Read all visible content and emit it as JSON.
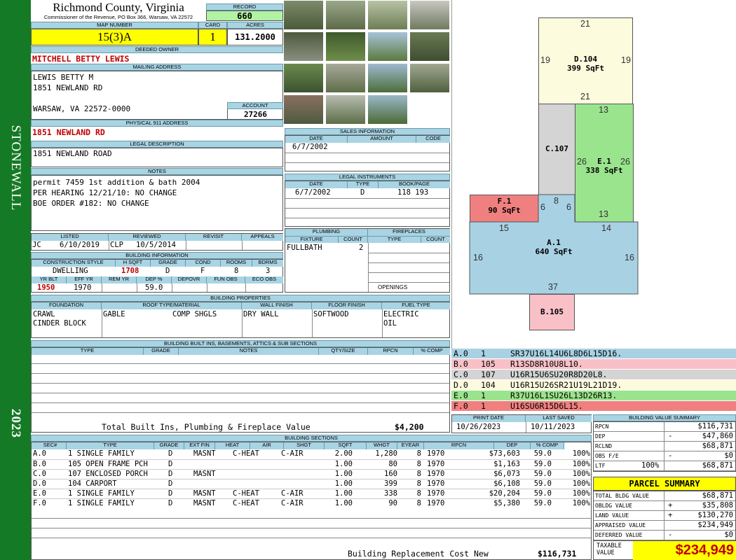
{
  "sidebar": {
    "name": "STONEWALL",
    "year": "2023"
  },
  "header": {
    "county": "Richmond County, Virginia",
    "commissioner": "Commissioner of the Revenue, PO Box 366, Warsaw, VA 22572",
    "record_label": "RECORD",
    "record": "660",
    "map_label": "MAP NUMBER",
    "map_number": "15(3)A",
    "card_label": "CARD",
    "card": "1",
    "acres_label": "ACRES",
    "acres": "131.2000"
  },
  "owner": {
    "deeded_label": "DEEDED OWNER",
    "deeded_owner": "MITCHELL BETTY LEWIS",
    "mailing_label": "MAILING ADDRESS",
    "mailing_lines": [
      "LEWIS BETTY M",
      "1851 NEWLAND RD",
      "",
      "WARSAW, VA 22572-0000"
    ],
    "account_label": "ACCOUNT",
    "account": "27266",
    "physical_label": "PHYSICAL 911 ADDRESS",
    "physical": "1851 NEWLAND RD",
    "legal_label": "LEGAL DESCRIPTION",
    "legal": "1851 NEWLAND ROAD",
    "notes_label": "NOTES",
    "notes": [
      "permit 7459 1st addition & bath 2004",
      "PER HEARING 12/21/10: NO CHANGE",
      "BOE ORDER #182: NO CHANGE"
    ]
  },
  "sales": {
    "label": "SALES INFORMATION",
    "cols": [
      "DATE",
      "AMOUNT",
      "CODE"
    ],
    "rows": [
      [
        "6/7/2002",
        "",
        ""
      ]
    ]
  },
  "legal_instruments": {
    "label": "LEGAL INSTRUMENTS",
    "cols": [
      "DATE",
      "TYPE",
      "BOOK/PAGE"
    ],
    "rows": [
      [
        "6/7/2002",
        "D",
        "118 193"
      ]
    ]
  },
  "listed": {
    "listed_label": "LISTED",
    "reviewed_label": "REVIEWED",
    "revisit_label": "REVISIT",
    "appeals_label": "APPEALS",
    "listed_by": "JC",
    "listed_date": "6/10/2019",
    "reviewed_by": "CLP",
    "reviewed_date": "10/5/2014"
  },
  "building_info": {
    "label": "BUILDING INFORMATION",
    "cols": [
      "CONSTRUCTION STYLE",
      "H SQFT",
      "GRADE",
      "COND",
      "ROOMS",
      "BDRMS"
    ],
    "values": [
      "DWELLING",
      "1708",
      "D",
      "F",
      "8",
      "3"
    ],
    "cols2": [
      "YR BLT",
      "EFF YR",
      "REM YR",
      "DEP %",
      "DEPOVR",
      "FUN OBS",
      "ECO OBS"
    ],
    "values2": [
      "1950",
      "1970",
      "",
      "59.0",
      "",
      "",
      ""
    ]
  },
  "plumbing": {
    "label": "PLUMBING",
    "cols": [
      "FIXTURE",
      "COUNT"
    ],
    "rows": [
      [
        "FULLBATH",
        "2"
      ]
    ]
  },
  "fireplaces": {
    "label": "FIREPLACES",
    "cols": [
      "TYPE",
      "COUNT"
    ],
    "openings_label": "OPENINGS"
  },
  "building_properties": {
    "label": "BUILDING PROPERTIES",
    "cols": [
      "FOUNDATION",
      "ROOF TYPE/MATERIAL",
      "WALL FINISH",
      "FLOOR FINISH",
      "FUEL TYPE"
    ],
    "foundation": [
      "CRAWL",
      "CINDER BLOCK"
    ],
    "roof_type": "GABLE",
    "roof_material": "COMP SHGLS",
    "wall": "DRY WALL",
    "floor": "SOFTWOOD",
    "fuel": [
      "ELECTRIC",
      "OIL"
    ]
  },
  "built_ins": {
    "label": "BUILDING BUILT INS, BASEMENTS, ATTICS & SUB SECTIONS",
    "cols": [
      "TYPE",
      "GRADE",
      "NOTES",
      "QTY/SIZE",
      "RPCN",
      "% COMP"
    ],
    "total_label": "Total Built Ins, Plumbing & Fireplace Value",
    "total": "$4,200"
  },
  "sections": {
    "label": "BUILDING SECTIONS",
    "cols": [
      "SEC#",
      "TYPE",
      "GRADE",
      "EXT FIN",
      "HEAT",
      "AIR",
      "SHGT",
      "SQFT",
      "WHGT",
      "EYEAR",
      "RPCN",
      "DEP",
      "% COMP"
    ],
    "rows": [
      [
        "A.0",
        "1 SINGLE FAMILY",
        "D",
        "MASNT",
        "C-HEAT",
        "C-AIR",
        "2.00",
        "1,280",
        "8",
        "1970",
        "$73,603",
        "59.0",
        "100%"
      ],
      [
        "B.0",
        "105 OPEN FRAME PCH",
        "D",
        "",
        "",
        "",
        "1.00",
        "80",
        "8",
        "1970",
        "$1,163",
        "59.0",
        "100%"
      ],
      [
        "C.0",
        "107 ENCLOSED PORCH",
        "D",
        "MASNT",
        "",
        "",
        "1.00",
        "160",
        "8",
        "1970",
        "$6,073",
        "59.0",
        "100%"
      ],
      [
        "D.0",
        "104 CARPORT",
        "D",
        "",
        "",
        "",
        "1.00",
        "399",
        "8",
        "1970",
        "$6,108",
        "59.0",
        "100%"
      ],
      [
        "E.0",
        "1 SINGLE FAMILY",
        "D",
        "MASNT",
        "C-HEAT",
        "C-AIR",
        "1.00",
        "338",
        "8",
        "1970",
        "$20,204",
        "59.0",
        "100%"
      ],
      [
        "F.0",
        "1 SINGLE FAMILY",
        "D",
        "MASNT",
        "C-HEAT",
        "C-AIR",
        "1.00",
        "90",
        "8",
        "1970",
        "$5,380",
        "59.0",
        "100%"
      ]
    ],
    "total_label": "Building Replacement Cost New",
    "total": "$116,731"
  },
  "sketch": {
    "areas": [
      {
        "id": "D",
        "code": "D.104",
        "sqft": "399 SqFt",
        "color": "#fdfbde"
      },
      {
        "id": "C",
        "code": "C.107",
        "sqft": "",
        "color": "#d4d4d4"
      },
      {
        "id": "E",
        "code": "E.1",
        "sqft": "338 SqFt",
        "color": "#9be48e"
      },
      {
        "id": "F",
        "code": "F.1",
        "sqft": "90 SqFt",
        "color": "#f08080"
      },
      {
        "id": "A",
        "code": "A.1",
        "sqft": "640 SqFt",
        "color": "#a8d2e4"
      },
      {
        "id": "B",
        "code": "B.105",
        "sqft": "",
        "color": "#f9c0c8"
      }
    ],
    "dims": {
      "d_top": "21",
      "d_left": "19",
      "d_right": "19",
      "d_bottom": "21",
      "e_top": "13",
      "e_left": "26",
      "e_right": "26",
      "e_bottom": "13",
      "c_bottom": "8",
      "c_l": "6",
      "c_r": "6",
      "a_top_l": "15",
      "a_top_r": "14",
      "a_left": "16",
      "a_right": "16",
      "a_bottom": "37"
    },
    "legend": [
      {
        "sec": "A.0",
        "code": "1",
        "path": "SR37U16L14U6L8D6L15D16.",
        "color": "#a8d2e4"
      },
      {
        "sec": "B.0",
        "code": "105",
        "path": "R13SD8R10U8L10.",
        "color": "#f9c0c8"
      },
      {
        "sec": "C.0",
        "code": "107",
        "path": "U16R15U6SU20R8D20L8.",
        "color": "#d4d4d4"
      },
      {
        "sec": "D.0",
        "code": "104",
        "path": "U16R15U26SR21U19L21D19.",
        "color": "#fdfbde"
      },
      {
        "sec": "E.0",
        "code": "1",
        "path": "R37U16L1SU26L13D26R13.",
        "color": "#9be48e"
      },
      {
        "sec": "F.0",
        "code": "1",
        "path": "U16SU6R15D6L15.",
        "color": "#f08080"
      }
    ]
  },
  "dates": {
    "print_label": "PRINT DATE",
    "print": "10/26/2023",
    "saved_label": "LAST SAVED",
    "saved": "10/11/2023"
  },
  "value_summary": {
    "label": "BUILDING VALUE SUMMARY",
    "rows": [
      {
        "label": "RPCN",
        "sign": "",
        "value": "$116,731",
        "pct": ""
      },
      {
        "label": "DEP",
        "sign": "-",
        "value": "$47,860",
        "pct": ""
      },
      {
        "label": "RCLND",
        "sign": "",
        "value": "$68,871",
        "pct": ""
      },
      {
        "label": "OBS F/E",
        "sign": "-",
        "value": "$0",
        "pct": ""
      },
      {
        "label": "LTF",
        "sign": "",
        "value": "$68,871",
        "pct": "100%"
      }
    ]
  },
  "parcel": {
    "label": "PARCEL SUMMARY",
    "rows": [
      {
        "label": "TOTAL BLDG VALUE",
        "sign": "",
        "value": "$68,871"
      },
      {
        "label": "OBLDG VALUE",
        "sign": "+",
        "value": "$35,808"
      },
      {
        "label": "LAND VALUE",
        "sign": "+",
        "value": "$130,270"
      },
      {
        "label": "APPRAISED VALUE",
        "sign": "",
        "value": "$234,949"
      },
      {
        "label": "DEFERRED VALUE",
        "sign": "-",
        "value": "$0"
      }
    ],
    "taxable_label_1": "TAXABLE",
    "taxable_label_2": "VALUE",
    "taxable": "$234,949"
  },
  "colors": {
    "sidebar": "#157a25",
    "header": "#a9d4e4",
    "yellow": "#ffff00",
    "record_green": "#b2f2a4"
  }
}
